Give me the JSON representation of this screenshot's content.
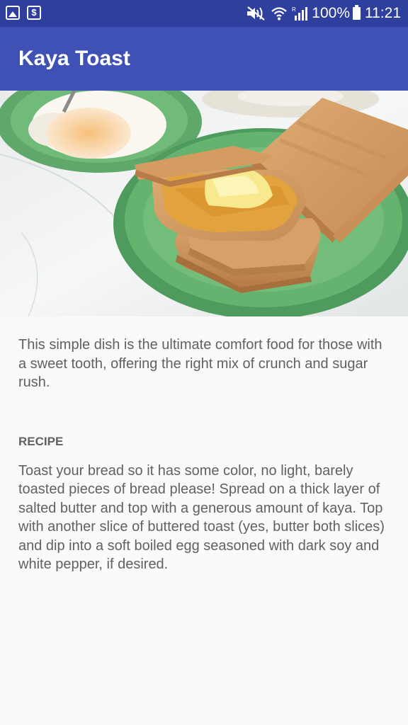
{
  "status_bar": {
    "battery": "100%",
    "time": "11:21",
    "icons": [
      "gallery-icon",
      "dollar-circle-icon",
      "mute-icon",
      "wifi-icon",
      "signal-icon",
      "battery-icon"
    ]
  },
  "app_bar": {
    "title": "Kaya Toast",
    "color": "#3f51b5"
  },
  "hero": {
    "image": "kaya toast with soft boiled eggs"
  },
  "content": {
    "intro": "This simple dish is the ultimate comfort food for those with a sweet tooth, offering the right mix of crunch and sugar rush.",
    "recipe_heading": "RECIPE",
    "recipe_body": "Toast your bread so it has some color, no light, barely toasted pieces of bread please! Spread on a thick layer of salted butter and top with a generous amount of kaya. Top with another slice of buttered toast (yes, butter both slices) and dip into a soft boiled egg seasoned with dark soy and white pepper, if desired."
  }
}
